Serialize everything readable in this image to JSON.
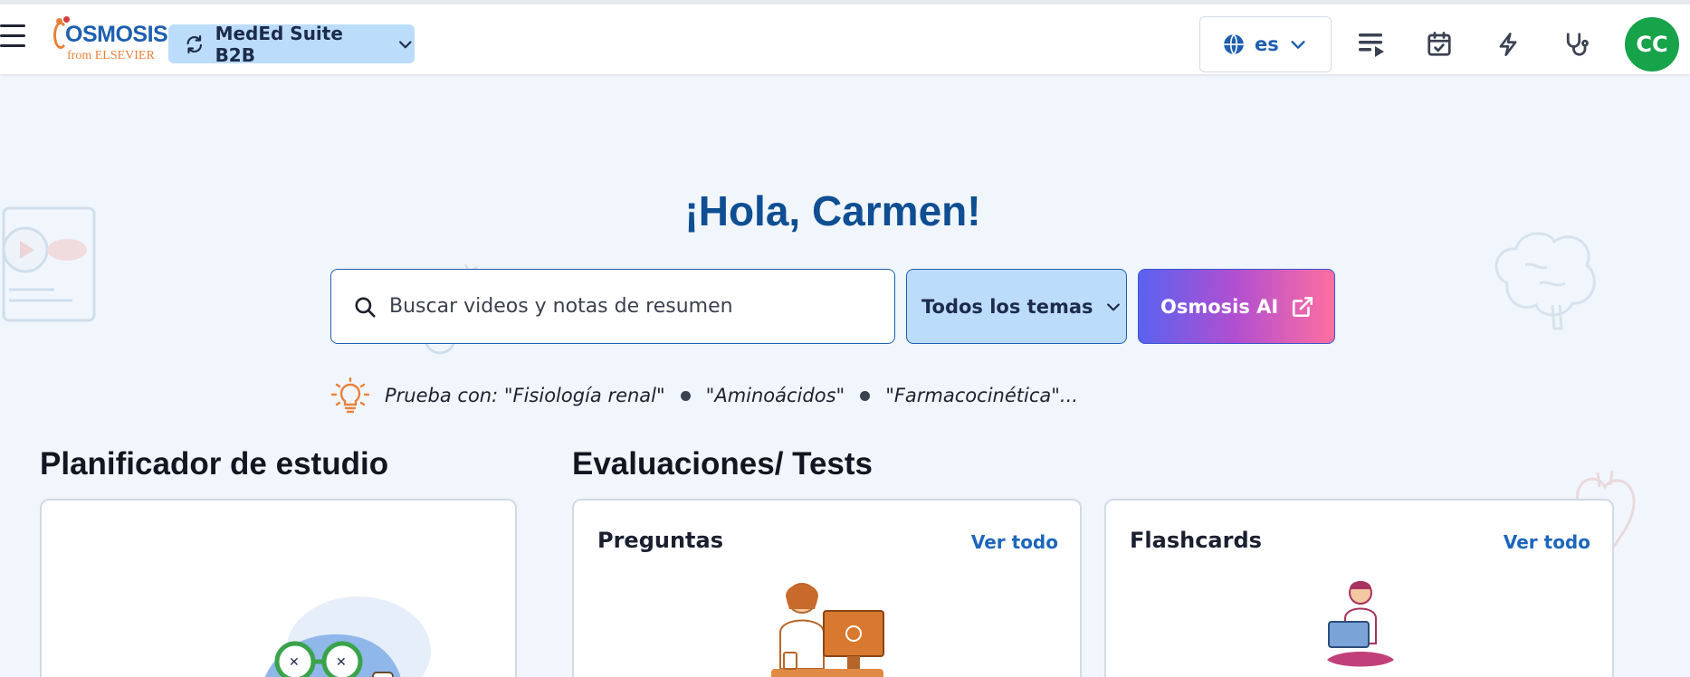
{
  "header": {
    "logo_text": "OSMOSIS",
    "logo_subtext": "from ELSEVIER",
    "suite_label": "MedEd Suite B2B",
    "language_label": "es",
    "avatar_initials": "CC",
    "icons": [
      "menu-icon",
      "playlist-icon",
      "calendar-check-icon",
      "bolt-icon",
      "stethoscope-icon"
    ]
  },
  "hero": {
    "greeting": "¡Hola, Carmen!",
    "search_placeholder": "Buscar videos y notas de resumen",
    "topics_label": "Todos los temas",
    "ai_label": "Osmosis AI",
    "suggest_prefix": "Prueba con: \"Fisiología renal\"",
    "suggest_2": "\"Aminoácidos\"",
    "suggest_3": "\"Farmacocinética\"..."
  },
  "sections": {
    "planner_title": "Planificador de estudio",
    "tests_title": "Evaluaciones/ Tests"
  },
  "cards": {
    "questions_title": "Preguntas",
    "questions_link": "Ver todo",
    "flashcards_title": "Flashcards",
    "flashcards_link": "Ver todo"
  },
  "colors": {
    "brand_blue": "#1e5fb0",
    "accent_orange": "#e9813a",
    "avatar_green": "#17a34a",
    "page_bg": "#f1f6fc"
  }
}
